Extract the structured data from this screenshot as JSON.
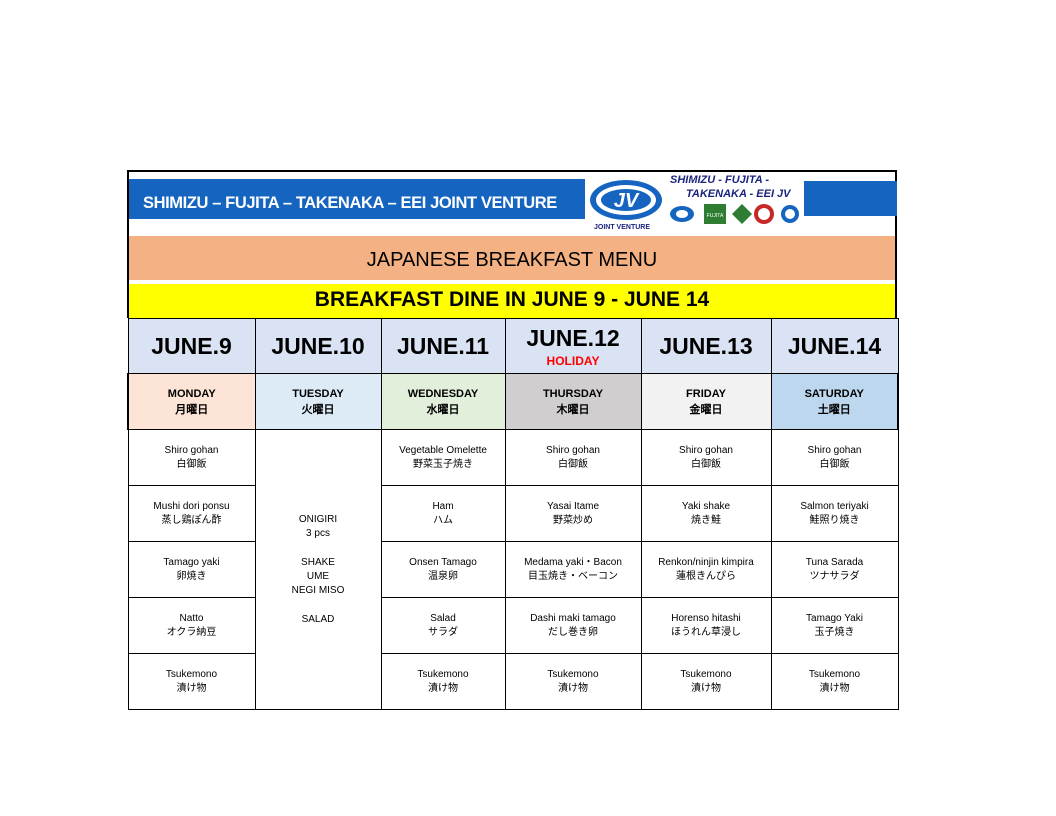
{
  "header": {
    "company_name": "SHIMIZU – FUJITA – TAKENAKA – EEI  JOINT VENTURE",
    "logo_line1": "SHIMIZU - FUJITA -",
    "logo_line2": "TAKENAKA - EEI  JV",
    "jv_label": "JOINT VENTURE",
    "menu_title": "JAPANESE BREAKFAST  MENU",
    "date_title": "BREAKFAST DINE IN JUNE 9 - JUNE 14"
  },
  "days": [
    {
      "date": "JUNE.9",
      "holiday": "",
      "weekday_en": "MONDAY",
      "weekday_jp": "月曜日",
      "color": "#fce4d6"
    },
    {
      "date": "JUNE.10",
      "holiday": "",
      "weekday_en": "TUESDAY",
      "weekday_jp": "火曜日",
      "color": "#ddebf7"
    },
    {
      "date": "JUNE.11",
      "holiday": "",
      "weekday_en": "WEDNESDAY",
      "weekday_jp": "水曜日",
      "color": "#e2efda"
    },
    {
      "date": "JUNE.12",
      "holiday": "HOLIDAY",
      "weekday_en": "THURSDAY",
      "weekday_jp": "木曜日",
      "color": "#d0cece"
    },
    {
      "date": "JUNE.13",
      "holiday": "",
      "weekday_en": "FRIDAY",
      "weekday_jp": "金曜日",
      "color": "#f2f2f2"
    },
    {
      "date": "JUNE.14",
      "holiday": "",
      "weekday_en": "SATURDAY",
      "weekday_jp": "土曜日",
      "color": "#bdd7ee"
    }
  ],
  "tuesday_special": [
    "ONIGIRI",
    "3 pcs",
    "",
    "SHAKE",
    "UME",
    "NEGI MISO",
    "",
    "SALAD"
  ],
  "menu_rows": [
    [
      {
        "en": "Shiro gohan",
        "jp": "白御飯"
      },
      null,
      {
        "en": "Vegetable Omelette",
        "jp": "野菜玉子焼き"
      },
      {
        "en": "Shiro gohan",
        "jp": "白御飯"
      },
      {
        "en": "Shiro gohan",
        "jp": "白御飯"
      },
      {
        "en": "Shiro gohan",
        "jp": "白御飯"
      }
    ],
    [
      {
        "en": "Mushi dori ponsu",
        "jp": "蒸し鶏ぽん酢"
      },
      null,
      {
        "en": "Ham",
        "jp": "ハム"
      },
      {
        "en": "Yasai Itame",
        "jp": "野菜炒め"
      },
      {
        "en": "Yaki shake",
        "jp": "焼き鮭"
      },
      {
        "en": "Salmon teriyaki",
        "jp": "鮭照り焼き"
      }
    ],
    [
      {
        "en": "Tamago yaki",
        "jp": "卵焼き"
      },
      null,
      {
        "en": "Onsen Tamago",
        "jp": "温泉卵"
      },
      {
        "en": "Medama yaki・Bacon",
        "jp": "目玉焼き・ベーコン"
      },
      {
        "en": "Renkon/ninjin kimpira",
        "jp": "蓮根きんぴら"
      },
      {
        "en": "Tuna Sarada",
        "jp": "ツナサラダ"
      }
    ],
    [
      {
        "en": "Natto",
        "jp": "オクラ納豆"
      },
      null,
      {
        "en": "Salad",
        "jp": "サラダ"
      },
      {
        "en": "Dashi maki tamago",
        "jp": "だし巻き卵"
      },
      {
        "en": "Horenso hitashi",
        "jp": "ほうれん草浸し"
      },
      {
        "en": "Tamago Yaki",
        "jp": "玉子焼き"
      }
    ],
    [
      {
        "en": "Tsukemono",
        "jp": "漬け物"
      },
      null,
      {
        "en": "Tsukemono",
        "jp": "漬け物"
      },
      {
        "en": "Tsukemono",
        "jp": "漬け物"
      },
      {
        "en": "Tsukemono",
        "jp": "漬け物"
      },
      {
        "en": "Tsukemono",
        "jp": "漬け物"
      }
    ]
  ]
}
